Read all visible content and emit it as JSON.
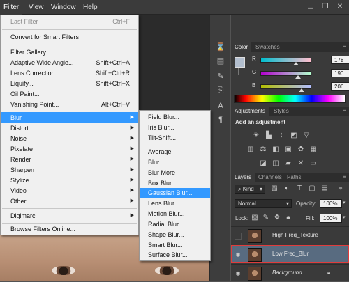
{
  "menubar": {
    "items": [
      "Filter",
      "View",
      "Window",
      "Help"
    ]
  },
  "window_controls": [
    "minimize",
    "restore",
    "close"
  ],
  "filter_menu": {
    "items": [
      {
        "label": "Last Filter",
        "shortcut": "Ctrl+F",
        "disabled": true
      },
      {
        "label": "Convert for Smart Filters"
      },
      {
        "label": "Filter Gallery..."
      },
      {
        "label": "Adaptive Wide Angle...",
        "shortcut": "Shift+Ctrl+A"
      },
      {
        "label": "Lens Correction...",
        "shortcut": "Shift+Ctrl+R"
      },
      {
        "label": "Liquify...",
        "shortcut": "Shift+Ctrl+X"
      },
      {
        "label": "Oil Paint..."
      },
      {
        "label": "Vanishing Point...",
        "shortcut": "Alt+Ctrl+V"
      },
      {
        "label": "Blur",
        "submenu": true,
        "highlighted": true
      },
      {
        "label": "Distort",
        "submenu": true
      },
      {
        "label": "Noise",
        "submenu": true
      },
      {
        "label": "Pixelate",
        "submenu": true
      },
      {
        "label": "Render",
        "submenu": true
      },
      {
        "label": "Sharpen",
        "submenu": true
      },
      {
        "label": "Stylize",
        "submenu": true
      },
      {
        "label": "Video",
        "submenu": true
      },
      {
        "label": "Other",
        "submenu": true
      },
      {
        "label": "Digimarc",
        "submenu": true
      },
      {
        "label": "Browse Filters Online..."
      }
    ]
  },
  "blur_submenu": {
    "items": [
      {
        "label": "Field Blur..."
      },
      {
        "label": "Iris Blur..."
      },
      {
        "label": "Tilt-Shift..."
      },
      {
        "label": "Average"
      },
      {
        "label": "Blur"
      },
      {
        "label": "Blur More"
      },
      {
        "label": "Box Blur..."
      },
      {
        "label": "Gaussian Blur...",
        "highlighted": true
      },
      {
        "label": "Lens Blur..."
      },
      {
        "label": "Motion Blur..."
      },
      {
        "label": "Radial Blur..."
      },
      {
        "label": "Shape Blur..."
      },
      {
        "label": "Smart Blur..."
      },
      {
        "label": "Surface Blur..."
      }
    ]
  },
  "color_panel": {
    "tabs": [
      "Color",
      "Swatches"
    ],
    "swatch_color": "#b2bece",
    "sliders": [
      {
        "label": "R",
        "value": "178",
        "fraction": 0.698
      },
      {
        "label": "G",
        "value": "190",
        "fraction": 0.745
      },
      {
        "label": "B",
        "value": "206",
        "fraction": 0.808
      }
    ]
  },
  "adjustments_panel": {
    "tabs": [
      "Adjustments",
      "Styles"
    ],
    "heading": "Add an adjustment",
    "row1_icons": [
      "brightness-contrast-icon",
      "levels-icon",
      "curves-icon",
      "exposure-icon",
      "vibrance-icon"
    ],
    "row2_icons": [
      "vibrance-icon",
      "hue-saturation-icon",
      "color-balance-icon",
      "black-white-icon",
      "photo-filter-icon",
      "channel-mixer-icon",
      "color-lookup-icon"
    ],
    "row3_icons": [
      "invert-icon",
      "posterize-icon",
      "threshold-icon",
      "selective-color-icon",
      "gradient-map-icon"
    ]
  },
  "layers_panel": {
    "tabs": [
      "Layers",
      "Channels",
      "Paths"
    ],
    "filter_kind": "Kind",
    "blend_mode": "Normal",
    "opacity_label": "Opacity:",
    "opacity_value": "100%",
    "lock_label": "Lock:",
    "fill_label": "Fill:",
    "fill_value": "100%",
    "layers": [
      {
        "name": "High Freq_Texture",
        "visible": false
      },
      {
        "name": "Low Freq_Blur",
        "visible": true,
        "selected": true
      },
      {
        "name": "Background",
        "visible": true,
        "locked": true
      }
    ]
  },
  "colors": {
    "menu_highlight": "#3399ff",
    "selected_layer_outline": "#e03c3c"
  }
}
